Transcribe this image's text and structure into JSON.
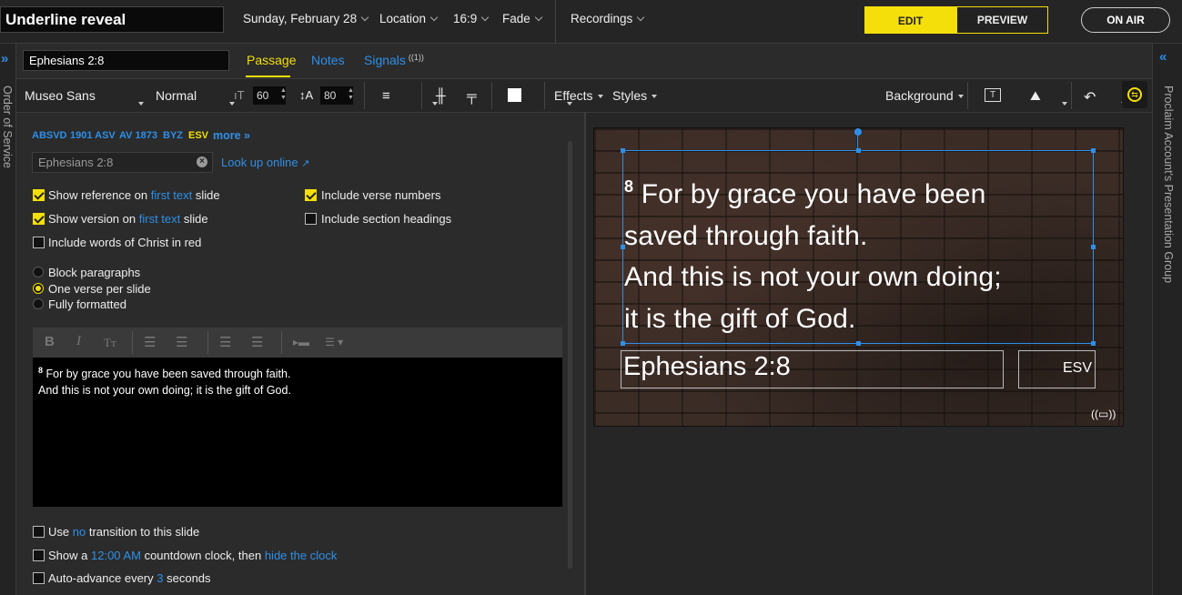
{
  "header": {
    "title": "Underline reveal",
    "date": "Sunday, February 28",
    "location": "Location",
    "aspect": "16:9",
    "transition": "Fade",
    "recordings": "Recordings",
    "edit": "EDIT",
    "preview": "PREVIEW",
    "on_air": "ON AIR"
  },
  "rails": {
    "left_label": "Order of Service",
    "right_label": "Proclaim Account's Presentation Group",
    "left_icon": "double-chevron-right",
    "right_icon": "double-chevron-left"
  },
  "tabs": {
    "reference": "Ephesians 2:8",
    "passage": "Passage",
    "notes": "Notes",
    "signals": "Signals",
    "signals_badge": "((1))"
  },
  "format": {
    "font": "Museo Sans",
    "weight": "Normal",
    "size_value": "60",
    "line_height_value": "80",
    "effects": "Effects",
    "styles": "Styles",
    "background": "Background"
  },
  "passage": {
    "versions": [
      "ABSVD",
      "1901 ASV",
      "AV 1873",
      "BYZ",
      "ESV",
      "more »"
    ],
    "selected_version": "ESV",
    "lookup_value": "Ephesians 2:8",
    "lookup_link": "Look up online",
    "show_reference_pre": "Show reference on",
    "show_reference_link": "first text",
    "show_reference_post": "slide",
    "show_version_pre": "Show version on",
    "show_version_link": "first text",
    "show_version_post": "slide",
    "words_of_christ": "Include words of Christ in red",
    "verse_numbers": "Include verse numbers",
    "section_headings": "Include section headings",
    "radio_block": "Block paragraphs",
    "radio_one_verse": "One verse per slide",
    "radio_formatted": "Fully formatted",
    "editor_verse_num": "8",
    "editor_line1": "For by grace you have been saved through faith.",
    "editor_line2": "And this is not your own doing; it is the gift of God.",
    "no_transition_pre": "Use",
    "no_transition_link": "no",
    "no_transition_post": "transition to this slide",
    "clock_pre": "Show a",
    "clock_time": "12:00 AM",
    "clock_mid": "countdown clock, then",
    "clock_link": "hide the clock",
    "auto_pre": "Auto-advance every",
    "auto_num": "3",
    "auto_post": "seconds"
  },
  "slide": {
    "verse_num": "8",
    "line1": "For by grace you have been",
    "line2": "saved through faith.",
    "line3": "And this is not your own doing;",
    "line4": "it is the gift of God.",
    "reference": "Ephesians 2:8",
    "version": "ESV"
  },
  "colors": {
    "accent_yellow": "#f5df0a",
    "link_blue": "#2e8fe8",
    "selection_blue": "#2e8fe8"
  }
}
